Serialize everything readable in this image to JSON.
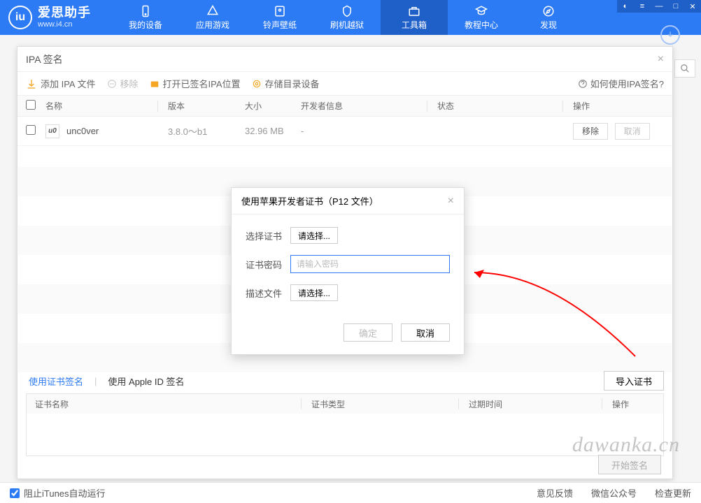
{
  "brand": {
    "name": "爱思助手",
    "site": "www.i4.cn"
  },
  "nav": {
    "items": [
      {
        "label": "我的设备"
      },
      {
        "label": "应用游戏"
      },
      {
        "label": "铃声壁纸"
      },
      {
        "label": "刷机越狱"
      },
      {
        "label": "工具箱"
      },
      {
        "label": "教程中心"
      },
      {
        "label": "发现"
      }
    ],
    "active_index": 4
  },
  "window": {
    "title": "IPA 签名",
    "toolbar": {
      "add": "添加 IPA 文件",
      "remove": "移除",
      "open_loc": "打开已签名IPA位置",
      "save_dev": "存储目录设备",
      "help": "如何使用IPA签名?"
    },
    "columns": {
      "name": "名称",
      "version": "版本",
      "size": "大小",
      "dev": "开发者信息",
      "status": "状态",
      "ops": "操作"
    },
    "rows": [
      {
        "name": "unc0ver",
        "version": "3.8.0～b1",
        "size": "32.96 MB",
        "dev": "-",
        "btn_remove": "移除",
        "btn_cancel": "取消"
      }
    ],
    "tabs": {
      "cert": "使用证书签名",
      "appleid": "使用 Apple ID 签名",
      "import": "导入证书"
    },
    "cert_cols": {
      "name": "证书名称",
      "type": "证书类型",
      "expire": "过期时间",
      "ops": "操作"
    },
    "start_sign": "开始签名"
  },
  "dialog": {
    "title": "使用苹果开发者证书（P12 文件）",
    "select_cert": "选择证书",
    "browse": "请选择...",
    "password_label": "证书密码",
    "password_placeholder": "请输入密码",
    "profile": "描述文件",
    "ok": "确定",
    "cancel": "取消"
  },
  "statusbar": {
    "block_itunes": "阻止iTunes自动运行",
    "feedback": "意见反馈",
    "wechat": "微信公众号",
    "update": "检查更新"
  },
  "watermark": "dawanka.cn"
}
